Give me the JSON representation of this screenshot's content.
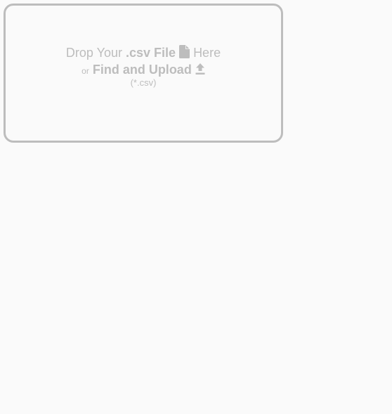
{
  "dropzone": {
    "drop_prefix": "Drop Your",
    "file_type": ".csv File",
    "drop_suffix": "Here",
    "or_label": "or",
    "upload_label": "Find and Upload",
    "accepted_formats": "(*.csv)",
    "file_icon": "file-icon",
    "upload_icon": "upload-icon"
  },
  "colors": {
    "background": "#fafafa",
    "border": "#bdbdbd",
    "text": "#bdbdbd"
  }
}
